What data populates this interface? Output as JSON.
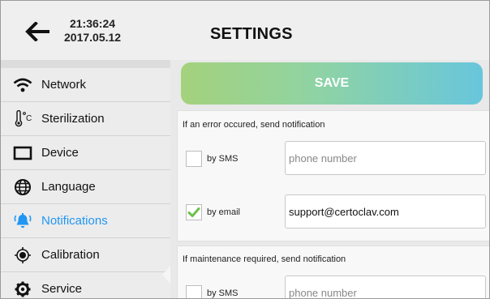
{
  "header": {
    "time": "21:36:24",
    "date": "2017.05.12",
    "title": "SETTINGS"
  },
  "sidebar": {
    "items": [
      {
        "label": "Network",
        "icon": "wifi-icon",
        "active": false
      },
      {
        "label": "Sterilization",
        "icon": "thermometer-icon",
        "active": false
      },
      {
        "label": "Device",
        "icon": "device-icon",
        "active": false
      },
      {
        "label": "Language",
        "icon": "globe-icon",
        "active": false
      },
      {
        "label": "Notifications",
        "icon": "bell-icon",
        "active": true
      },
      {
        "label": "Calibration",
        "icon": "target-icon",
        "active": false
      },
      {
        "label": "Service",
        "icon": "gear-icon",
        "active": false
      }
    ]
  },
  "main": {
    "save_label": "SAVE",
    "error_section": {
      "title": "If an error occured, send notification",
      "sms_label": "by SMS",
      "sms_checked": false,
      "sms_placeholder": "phone number",
      "email_label": "by email",
      "email_checked": true,
      "email_value": "support@certoclav.com"
    },
    "maintenance_section": {
      "title": "If maintenance required, send notification",
      "sms_label": "by SMS",
      "sms_checked": false,
      "sms_placeholder": "phone number"
    }
  },
  "colors": {
    "accent": "#2196f3",
    "check": "#6cc24a",
    "save_gradient_start": "#a4d27c",
    "save_gradient_end": "#68c6dc"
  }
}
